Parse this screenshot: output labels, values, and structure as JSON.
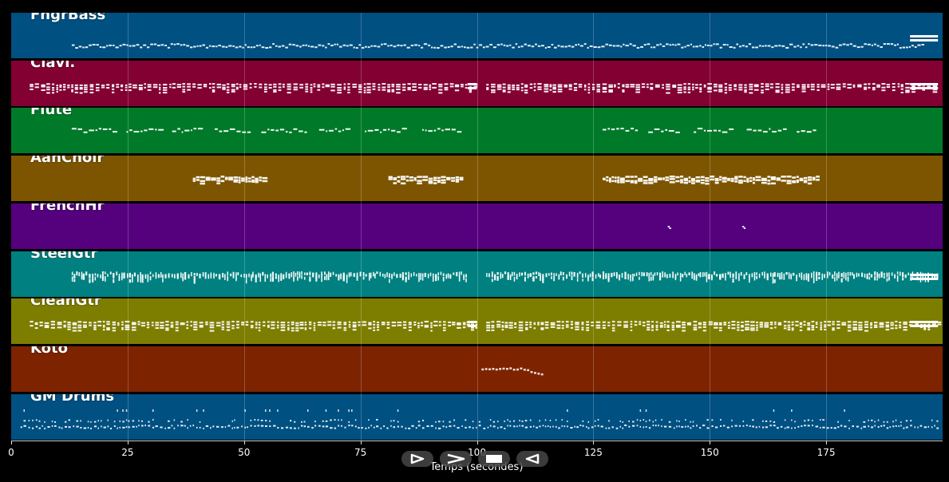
{
  "tracks": [
    {
      "name": "FngrBass",
      "color": "#005082",
      "pattern": "dense-line",
      "active": [
        [
          13,
          196
        ]
      ],
      "sustain": [
        [
          193,
          199
        ]
      ]
    },
    {
      "name": "Clavi.",
      "color": "#820032",
      "pattern": "chords",
      "active": [
        [
          4,
          100
        ],
        [
          102,
          199
        ]
      ],
      "sustain": [
        [
          98,
          100
        ],
        [
          193,
          199
        ]
      ]
    },
    {
      "name": "Flute",
      "color": "#007a28",
      "pattern": "phrases",
      "active": [
        [
          13,
          97
        ],
        [
          127,
          173
        ]
      ],
      "sustain": []
    },
    {
      "name": "AahChoir",
      "color": "#7d5500",
      "pattern": "blocks",
      "active": [
        [
          39,
          55
        ],
        [
          81,
          97
        ],
        [
          127,
          173
        ]
      ],
      "sustain": []
    },
    {
      "name": "FrenchHr",
      "color": "#55007d",
      "pattern": "sparse",
      "active": [
        [
          141,
          142
        ],
        [
          157,
          158
        ]
      ],
      "sustain": []
    },
    {
      "name": "SteelGtr",
      "color": "#008080",
      "pattern": "strums",
      "active": [
        [
          13,
          98
        ],
        [
          102,
          199
        ]
      ],
      "sustain": [
        [
          193,
          199
        ]
      ]
    },
    {
      "name": "CleanGtr",
      "color": "#7d7d00",
      "pattern": "chords",
      "active": [
        [
          4,
          100
        ],
        [
          102,
          199
        ]
      ],
      "sustain": [
        [
          98,
          100
        ],
        [
          193,
          199
        ]
      ]
    },
    {
      "name": "Koto",
      "color": "#7d2300",
      "pattern": "run",
      "active": [
        [
          101,
          114
        ]
      ],
      "sustain": []
    },
    {
      "name": "GM Drums",
      "color": "#005082",
      "pattern": "drums",
      "active": [
        [
          2,
          199
        ]
      ],
      "sustain": []
    }
  ],
  "axis": {
    "xlabel": "Temps (secondes)",
    "xlim": [
      0,
      200
    ],
    "ticks": [
      0,
      25,
      50,
      75,
      100,
      125,
      150,
      175
    ]
  },
  "controls": [
    {
      "name": "play-button",
      "icon": "play-icon"
    },
    {
      "name": "fast-forward-button",
      "icon": "fast-forward-icon"
    },
    {
      "name": "stop-button",
      "icon": "stop-icon"
    },
    {
      "name": "rewind-button",
      "icon": "rewind-icon"
    }
  ]
}
